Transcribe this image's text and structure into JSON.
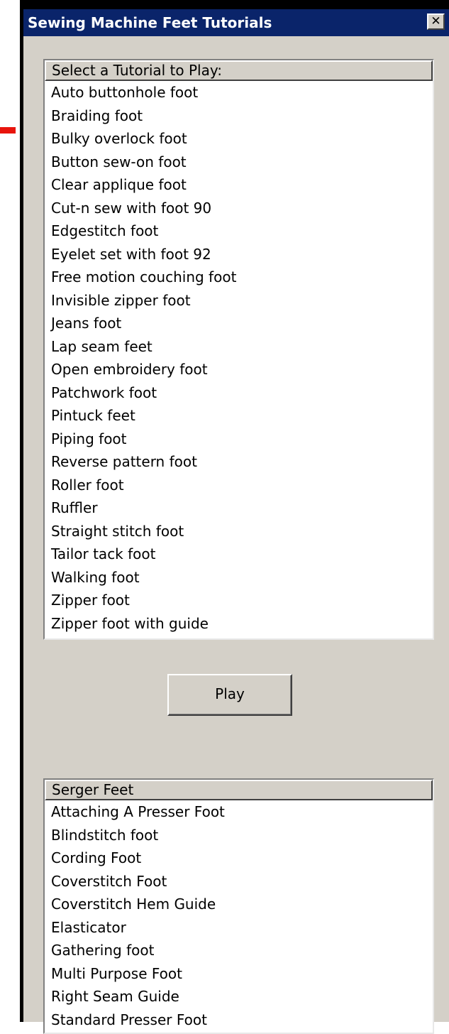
{
  "window": {
    "title": "Sewing Machine Feet Tutorials",
    "close_glyph": "✕"
  },
  "tutorials": {
    "header": "Select a Tutorial to Play:",
    "items": [
      "Auto buttonhole foot",
      "Braiding foot",
      "Bulky overlock foot",
      "Button sew-on foot",
      "Clear applique foot",
      "Cut-n sew with foot 90",
      "Edgestitch foot",
      "Eyelet set with foot 92",
      "Free motion couching foot",
      "Invisible zipper foot",
      "Jeans foot",
      "Lap seam feet",
      "Open embroidery foot",
      "Patchwork foot",
      "Pintuck feet",
      "Piping foot",
      "Reverse pattern foot",
      "Roller foot",
      "Ruffler",
      "Straight stitch foot",
      "Tailor tack foot",
      "Walking foot",
      "Zipper foot",
      "Zipper foot with guide"
    ]
  },
  "play_button": {
    "label": "Play"
  },
  "serger": {
    "header": "Serger Feet",
    "items": [
      "Attaching A Presser Foot",
      "Blindstitch foot",
      "Cording Foot",
      "Coverstitch Foot",
      "Coverstitch Hem Guide",
      "Elasticator",
      "Gathering foot",
      "Multi Purpose Foot",
      "Right Seam Guide",
      "Standard Presser Foot"
    ]
  },
  "colors": {
    "titlebar": "#0a246a",
    "face": "#d4d0c8",
    "marker": "#e8140c"
  }
}
